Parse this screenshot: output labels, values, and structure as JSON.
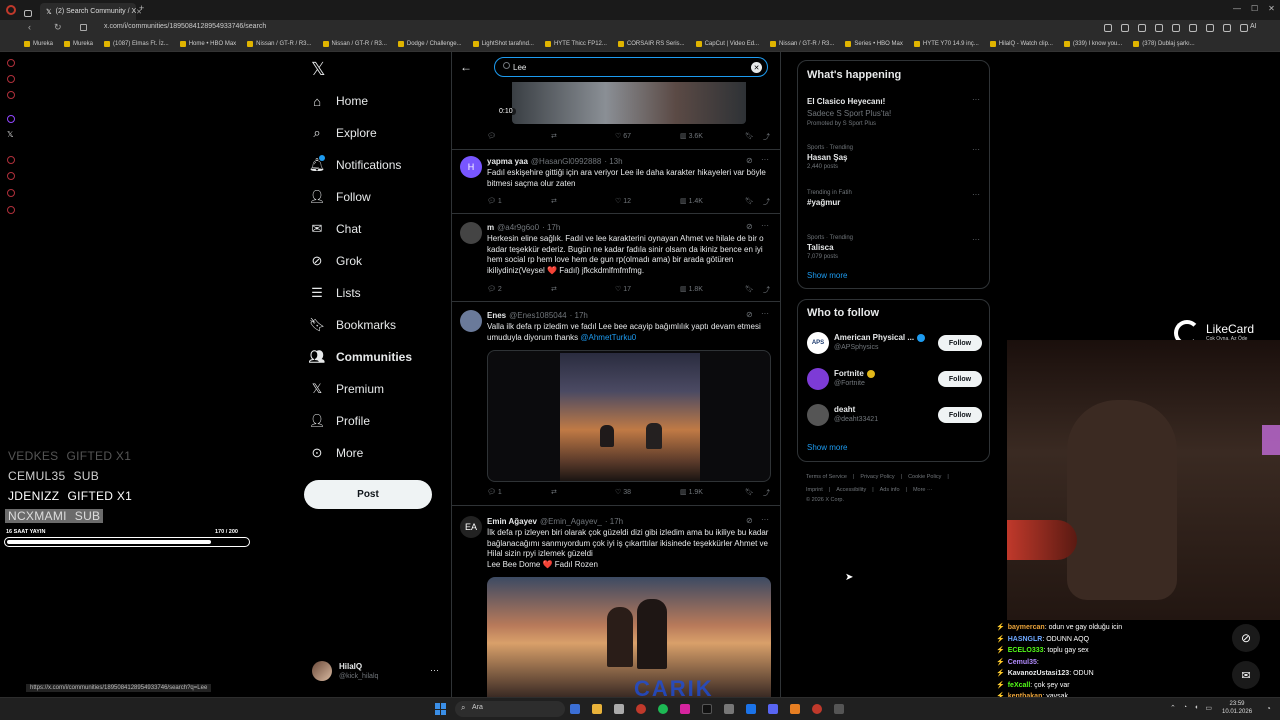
{
  "browser": {
    "active_tab": "(2) Search Community / X",
    "new_tab": "+",
    "url": "x.com/i/communities/1895084128954933746/search",
    "bookmarks": [
      "Mureka",
      "Mureka",
      "(1087) Elmas Ft. İz...",
      "Home • HBO Max",
      "Nissan / GT-R / R3...",
      "Nissan / GT-R / R3...",
      "Dodge / Challenge...",
      "LightShot tarafınd...",
      "HYTE Thicc FP12...",
      "CORSAIR RS Seris...",
      "CapCut | Video Ed...",
      "Nissan / GT-R / R3...",
      "Series • HBO Max",
      "HYTE Y70 14.9 inç...",
      "HilalQ - Watch clip...",
      "(339) I know you...",
      "(378) Dublaj şarkı..."
    ],
    "ai_label": "AI",
    "status_url": "https://x.com/i/communities/1895084128954933746/search?q=Lee"
  },
  "nav": {
    "items": [
      {
        "label": "Home",
        "icon": "home-icon",
        "bold": false
      },
      {
        "label": "Explore",
        "icon": "search-icon",
        "bold": false
      },
      {
        "label": "Notifications",
        "icon": "bell-icon",
        "bold": false
      },
      {
        "label": "Follow",
        "icon": "person-add-icon",
        "bold": false
      },
      {
        "label": "Chat",
        "icon": "mail-icon",
        "bold": false
      },
      {
        "label": "Grok",
        "icon": "grok-icon",
        "bold": false
      },
      {
        "label": "Lists",
        "icon": "list-icon",
        "bold": false
      },
      {
        "label": "Bookmarks",
        "icon": "bookmark-icon",
        "bold": false
      },
      {
        "label": "Communities",
        "icon": "people-icon",
        "bold": true
      },
      {
        "label": "Premium",
        "icon": "x-logo-icon",
        "bold": false
      },
      {
        "label": "Profile",
        "icon": "person-icon",
        "bold": false
      },
      {
        "label": "More",
        "icon": "more-circle-icon",
        "bold": false
      }
    ],
    "post_label": "Post",
    "account": {
      "name": "HilalQ",
      "handle": "@kick_hilalq"
    }
  },
  "search": {
    "query": "Lee"
  },
  "feed": {
    "video_time": "0:10",
    "top_actions": {
      "likes": "67",
      "views": "3.6K"
    },
    "tweets": [
      {
        "avatar_letter": "H",
        "name": "yapma yaa",
        "handle": "@HasanGl0992888",
        "time": "· 13h",
        "text": "Fadıl eskişehire gittiği için ara veriyor Lee ile daha karakter hikayeleri var böyle bitmesi saçma olur zaten",
        "replies": "1",
        "likes": "12",
        "views": "1.4K"
      },
      {
        "avatar_letter": "",
        "name": "m",
        "handle": "@a4r9g6o0",
        "time": "· 17h",
        "text": "Herkesin eline sağlık. Fadıl ve lee karakterini oynayan Ahmet ve hilale de bir o kadar teşekkür ederiz. Bugün ne kadar fadıla sinir olsam da ikiniz bence en iyi hem social rp hem love hem de gun rp(olmadı ama) bir arada götüren ikiliydiniz(Veysel ❤️ Fadıl) jfkckdmlfmfmfmg.",
        "replies": "2",
        "likes": "17",
        "views": "1.8K"
      },
      {
        "avatar_letter": "",
        "name": "Enes",
        "handle": "@Enes1085044",
        "time": "· 17h",
        "text": "Valla ilk defa rp izledim ve fadıl Lee bee acayip bağımlılık yaptı devam etmesi umuduyla diyorum thanks ",
        "mention": "@AhmetTurku0",
        "replies": "1",
        "likes": "38",
        "views": "1.9K"
      },
      {
        "avatar_letter": "EA",
        "name": "Emin Ağayev",
        "handle": "@Emin_Agayev_",
        "time": "· 17h",
        "text": "İlk defa rp izleyen biri olarak çok güzeldi dizi gibi izledim ama bu ikiliye bu kadar bağlanacağımı sanmıyordum çok iyi iş çıkarttılar ikisinede teşekkürler Ahmet ve Hilal sizin rpyi izlemek güzeldi",
        "text2": "Lee Bee Dome ❤️ Fadıl Rozen"
      }
    ],
    "watermark": "CARIK"
  },
  "happening": {
    "title": "What's happening",
    "promo": {
      "name": "El Clasico Heyecanı!",
      "sub": "Sadece S Sport Plus'ta!",
      "promoted": "Promoted by S Sport Plus"
    },
    "trends": [
      {
        "cat": "Sports · Trending",
        "name": "Hasan Şaş",
        "posts": "2,440 posts"
      },
      {
        "cat": "Trending in Fatih",
        "name": "#yağmur",
        "posts": ""
      },
      {
        "cat": "Sports · Trending",
        "name": "Talisca",
        "posts": "7,079 posts"
      }
    ],
    "show_more": "Show more"
  },
  "who_to_follow": {
    "title": "Who to follow",
    "users": [
      {
        "name": "American Physical ...",
        "handle": "@APSphysics",
        "verified": "blue",
        "avatar": "APS"
      },
      {
        "name": "Fortnite",
        "handle": "@Fortnite",
        "verified": "gold",
        "avatar": ""
      },
      {
        "name": "deaht",
        "handle": "@deaht33421",
        "verified": "",
        "avatar": ""
      }
    ],
    "follow_label": "Follow",
    "show_more": "Show more"
  },
  "footer": {
    "links_row1": [
      "Terms of Service",
      "|",
      "Privacy Policy",
      "|",
      "Cookie Policy",
      "|"
    ],
    "links_row2": [
      "Imprint",
      "|",
      "Accessibility",
      "|",
      "Ads info",
      "|",
      "More ···"
    ],
    "copyright": "© 2026 X Corp."
  },
  "overlay": {
    "gifts": [
      {
        "name": "VEDKES",
        "tag": "GIFTED X1",
        "color": "#555555"
      },
      {
        "name": "CEMUL35",
        "tag": "SUB",
        "color": "#cfcfcf"
      },
      {
        "name": "JDENIZZ",
        "tag": "GIFTED X1",
        "color": "#ffffff"
      },
      {
        "name": "NCXMAMI",
        "tag": "SUB",
        "color": "#dddddd",
        "highlight": true
      }
    ],
    "progress_label": "16 SAAT YAYIN",
    "progress_count": "170  / 200",
    "progress_fraction": 0.85,
    "sponsor_name": "LikeCard",
    "sponsor_tag": "Çok Oyna. Az Öde",
    "chat": [
      {
        "user": "baymercan",
        "msg": ": odun ve gay olduğu icin",
        "color": "#e8a23a"
      },
      {
        "user": "HASNGLR",
        "msg": ": ODUNN AQQ",
        "color": "#6ea8ff"
      },
      {
        "user": "ECELO333",
        "msg": ": toplu gay sex",
        "color": "#53fc18"
      },
      {
        "user": "Cemul35",
        "msg": ": ",
        "color": "#b38cff"
      },
      {
        "user": "KavanozUstasi123",
        "msg": ": ODUN",
        "color": "#e7e9ea"
      },
      {
        "user": "feXcall",
        "msg": ": çok şey var",
        "color": "#53fc18"
      },
      {
        "user": "kenthakan",
        "msg": ": yavşak",
        "color": "#e8a23a"
      }
    ]
  },
  "taskbar": {
    "search": "Ara",
    "time": "23:59",
    "date": "10.01.2026"
  }
}
